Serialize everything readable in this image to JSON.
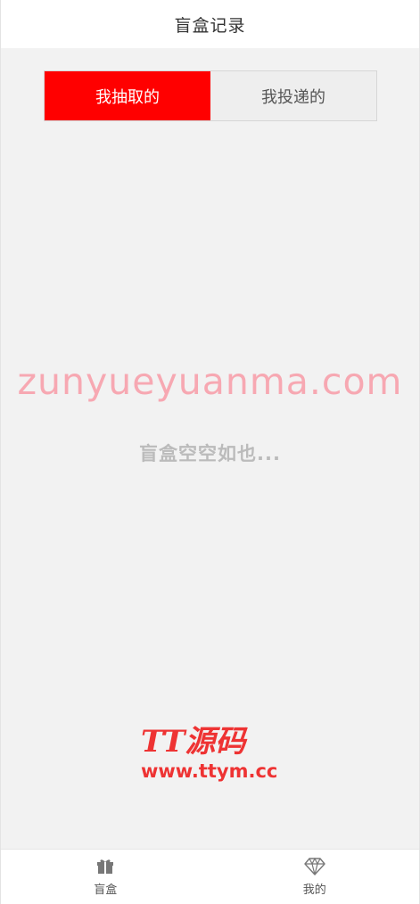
{
  "header": {
    "title": "盲盒记录"
  },
  "tabs": [
    {
      "label": "我抽取的",
      "active": true
    },
    {
      "label": "我投递的",
      "active": false
    }
  ],
  "watermark": {
    "text": "zunyueyuanma.com"
  },
  "empty_state": {
    "text": "盲盒空空如也..."
  },
  "logo": {
    "line1": "TT源码",
    "line2": "www.ttym.cc"
  },
  "tabbar": {
    "items": [
      {
        "label": "盲盒",
        "icon": "gift-icon"
      },
      {
        "label": "我的",
        "icon": "diamond-icon"
      }
    ]
  },
  "colors": {
    "accent": "#ff0000",
    "background": "#f2f2f2",
    "watermark": "#f7a8b2",
    "logo": "#ee3333"
  }
}
